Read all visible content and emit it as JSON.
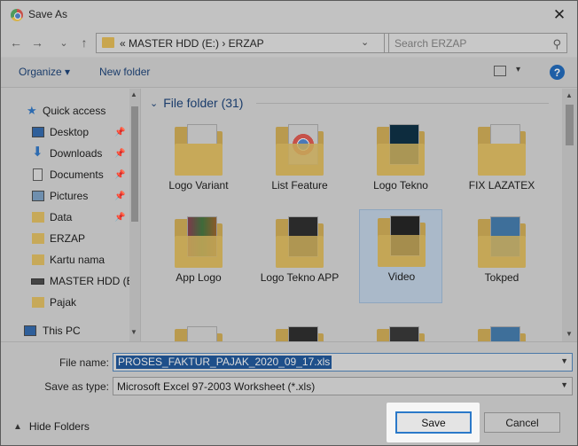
{
  "window": {
    "title": "Save As",
    "close_glyph": "✕"
  },
  "address": {
    "back_glyph": "←",
    "forward_glyph": "→",
    "dropdown_glyph": "⌄",
    "up_glyph": "↑",
    "crumbs": "«  MASTER HDD (E:)  ›  ERZAP",
    "refresh_glyph": "↻",
    "search_placeholder": "Search ERZAP"
  },
  "toolbar": {
    "organize_label": "Organize ▾",
    "new_folder_label": "New folder",
    "view_glyph": "▾",
    "help_glyph": "?"
  },
  "sidebar": {
    "items": [
      {
        "label": "Quick access",
        "icon": "star-icon",
        "pinned": false
      },
      {
        "label": "Desktop",
        "icon": "desktop-icon",
        "pinned": true
      },
      {
        "label": "Downloads",
        "icon": "download-icon",
        "pinned": true
      },
      {
        "label": "Documents",
        "icon": "document-icon",
        "pinned": true
      },
      {
        "label": "Pictures",
        "icon": "pictures-icon",
        "pinned": true
      },
      {
        "label": "Data",
        "icon": "folder-icon",
        "pinned": true
      },
      {
        "label": "ERZAP",
        "icon": "folder-icon",
        "pinned": false
      },
      {
        "label": "Kartu nama",
        "icon": "folder-icon",
        "pinned": false
      },
      {
        "label": "MASTER HDD (E",
        "icon": "drive-icon",
        "pinned": false
      },
      {
        "label": "Pajak",
        "icon": "folder-icon",
        "pinned": false
      },
      {
        "label": "This PC",
        "icon": "computer-icon",
        "pinned": false
      }
    ],
    "pin_glyph": "📌"
  },
  "main": {
    "group_label": "File folder (31)",
    "group_chevron": "⌄",
    "folders": [
      {
        "name": "Logo Variant",
        "selected": false
      },
      {
        "name": "List Feature",
        "selected": false
      },
      {
        "name": "Logo Tekno",
        "selected": false
      },
      {
        "name": "FIX LAZATEX",
        "selected": false
      },
      {
        "name": "App Logo",
        "selected": false
      },
      {
        "name": "Logo Tekno APP",
        "selected": false
      },
      {
        "name": "Video",
        "selected": true
      },
      {
        "name": "Tokped",
        "selected": false
      }
    ]
  },
  "bottom": {
    "file_name_label": "File name:",
    "file_name_value": "PROSES_FAKTUR_PAJAK_2020_09_17.xls",
    "save_type_label": "Save as type:",
    "save_type_value": "Microsoft Excel 97-2003 Worksheet (*.xls)",
    "hide_folders_label": "Hide Folders",
    "save_label": "Save",
    "cancel_label": "Cancel"
  },
  "colors": {
    "accent": "#2b79c9",
    "selection": "#1e4f8a",
    "folder": "#c7a959"
  }
}
